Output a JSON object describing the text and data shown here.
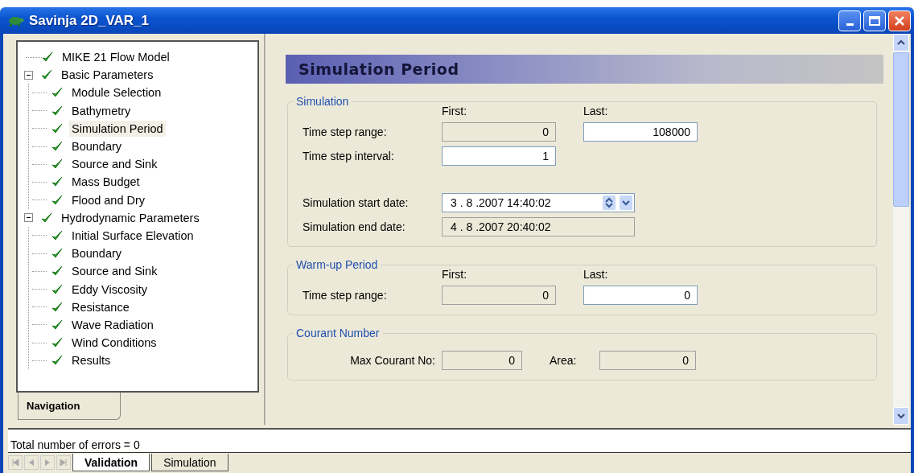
{
  "window": {
    "title": "Savinja 2D_VAR_1"
  },
  "navigation": {
    "tree": [
      {
        "label": "MIKE 21 Flow Model",
        "checked": true,
        "selected": false
      },
      {
        "label": "Basic Parameters",
        "checked": true,
        "selected": false,
        "expanded": true,
        "children": [
          {
            "label": "Module Selection",
            "checked": true,
            "selected": false
          },
          {
            "label": "Bathymetry",
            "checked": true,
            "selected": false
          },
          {
            "label": "Simulation Period",
            "checked": true,
            "selected": true
          },
          {
            "label": "Boundary",
            "checked": true,
            "selected": false
          },
          {
            "label": "Source and Sink",
            "checked": true,
            "selected": false
          },
          {
            "label": "Mass Budget",
            "checked": true,
            "selected": false
          },
          {
            "label": "Flood and Dry",
            "checked": true,
            "selected": false
          }
        ]
      },
      {
        "label": "Hydrodynamic Parameters",
        "checked": true,
        "selected": false,
        "expanded": true,
        "children": [
          {
            "label": "Initial Surface Elevation",
            "checked": true,
            "selected": false
          },
          {
            "label": "Boundary",
            "checked": true,
            "selected": false
          },
          {
            "label": "Source and Sink",
            "checked": true,
            "selected": false
          },
          {
            "label": "Eddy Viscosity",
            "checked": true,
            "selected": false
          },
          {
            "label": "Resistance",
            "checked": true,
            "selected": false
          },
          {
            "label": "Wave Radiation",
            "checked": true,
            "selected": false
          },
          {
            "label": "Wind Conditions",
            "checked": true,
            "selected": false
          },
          {
            "label": "Results",
            "checked": true,
            "selected": false
          }
        ]
      }
    ],
    "tabs": [
      {
        "label": "Navigation",
        "selected": true
      }
    ]
  },
  "page": {
    "header": "Simulation Period",
    "groups": [
      {
        "kind": "range",
        "title": "Simulation",
        "column_labels": [
          "First:",
          "Last:"
        ],
        "rows": [
          {
            "cells": [
              {
                "kind": "label",
                "text": "Time step range:"
              },
              {
                "kind": "field",
                "value": "0",
                "disabled": true
              },
              {
                "kind": "field",
                "value": "108000",
                "disabled": false
              }
            ]
          },
          {
            "cells": [
              {
                "kind": "label",
                "text": "Time step interval:"
              },
              {
                "kind": "field",
                "value": "1",
                "disabled": false
              }
            ]
          },
          {
            "cells": [
              {
                "kind": "label",
                "text": "Simulation start date:"
              },
              {
                "kind": "date",
                "value": "3 . 8 .2007 14:40:02",
                "disabled": false
              }
            ]
          },
          {
            "cells": [
              {
                "kind": "label",
                "text": "Simulation end date:"
              },
              {
                "kind": "date",
                "value": "4 . 8 .2007 20:40:02",
                "disabled": true
              }
            ]
          }
        ]
      },
      {
        "kind": "range",
        "title": "Warm-up Period",
        "column_labels": [
          "First:",
          "Last:"
        ],
        "rows": [
          {
            "cells": [
              {
                "kind": "label",
                "text": "Time step range:"
              },
              {
                "kind": "field",
                "value": "0",
                "disabled": true
              },
              {
                "kind": "field",
                "value": "0",
                "disabled": false
              }
            ]
          }
        ]
      },
      {
        "kind": "courant",
        "title": "Courant Number",
        "rows": [
          {
            "cells": [
              {
                "kind": "label",
                "text": "Max Courant No:"
              },
              {
                "kind": "field",
                "value": "0",
                "disabled": true
              },
              {
                "kind": "label",
                "text": "Area:"
              },
              {
                "kind": "field",
                "value": "0",
                "disabled": true
              }
            ]
          }
        ]
      }
    ]
  },
  "output": {
    "message": "Total number of errors = 0",
    "tabs": [
      {
        "label": "Validation",
        "selected": true
      },
      {
        "label": "Simulation",
        "selected": false
      }
    ]
  }
}
